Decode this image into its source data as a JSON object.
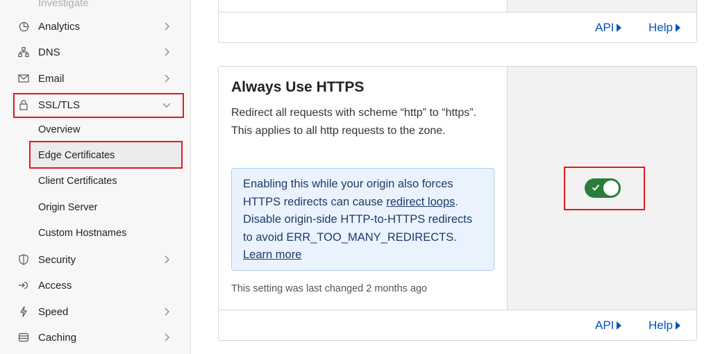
{
  "sidebar": {
    "faded_top": "Investigate",
    "items": [
      {
        "label": "Analytics",
        "icon": "analytics-icon"
      },
      {
        "label": "DNS",
        "icon": "dns-icon"
      },
      {
        "label": "Email",
        "icon": "email-icon"
      },
      {
        "label": "SSL/TLS",
        "icon": "lock-icon"
      },
      {
        "label": "Security",
        "icon": "shield-icon"
      },
      {
        "label": "Access",
        "icon": "access-icon"
      },
      {
        "label": "Speed",
        "icon": "bolt-icon"
      },
      {
        "label": "Caching",
        "icon": "caching-icon"
      }
    ],
    "ssl_sub": [
      {
        "label": "Overview"
      },
      {
        "label": "Edge Certificates"
      },
      {
        "label": "Client Certificates"
      },
      {
        "label": "Origin Server"
      },
      {
        "label": "Custom Hostnames"
      }
    ]
  },
  "top_card": {
    "api_label": "API",
    "help_label": "Help"
  },
  "https_card": {
    "title": "Always Use HTTPS",
    "description": "Redirect all requests with scheme “http” to “https”. This applies to all http requests to the zone.",
    "note_text_1": "Enabling this while your origin also forces HTTPS redirects can cause ",
    "note_link_1": "redirect loops",
    "note_text_2": ". Disable origin-side HTTP-to-HTTPS redirects to avoid ERR_TOO_MANY_REDIRECTS. ",
    "note_link_2": "Learn more",
    "last_changed": "This setting was last changed 2 months ago",
    "toggle_on": true,
    "api_label": "API",
    "help_label": "Help"
  },
  "colors": {
    "accent_link": "#0051c3",
    "toggle_on": "#2c7c3a",
    "highlight": "#e0191e",
    "note_bg": "#eaf3fd"
  }
}
